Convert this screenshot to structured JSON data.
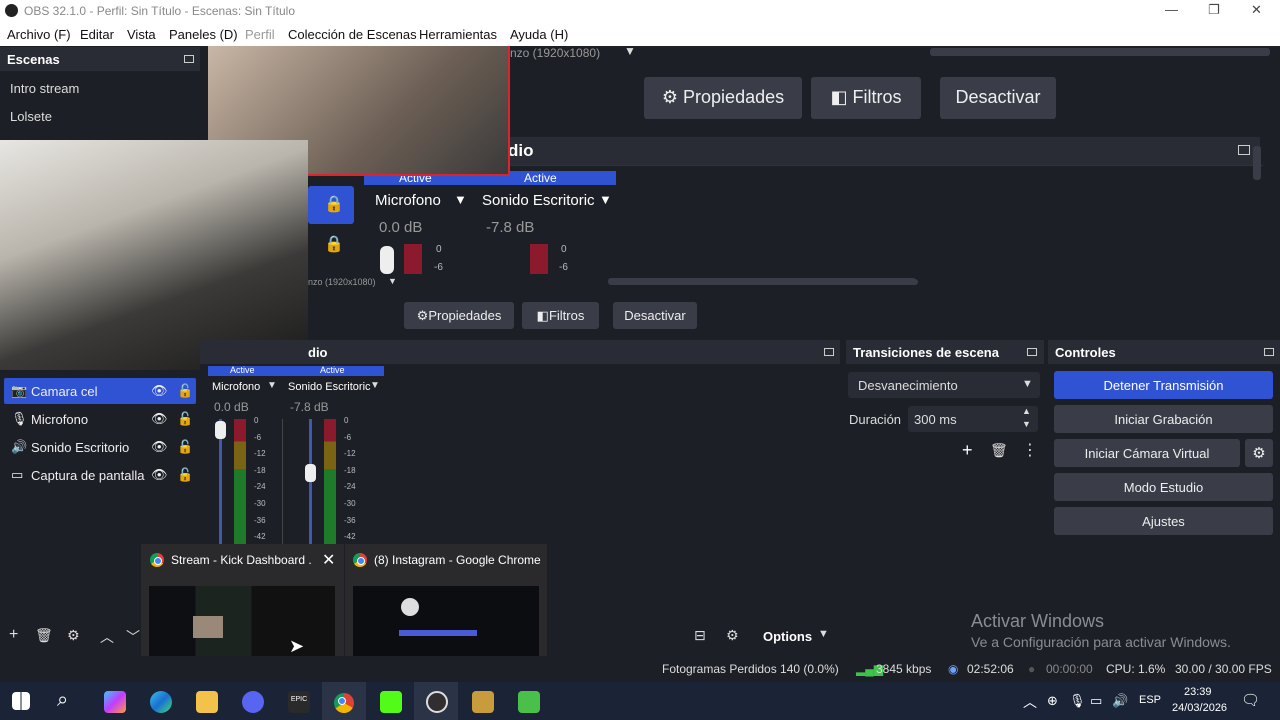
{
  "window": {
    "title": "OBS 32.1.0 - Perfil: Sin Título - Escenas: Sin Título",
    "minimize": "—",
    "maximize": "❐",
    "close": "✕"
  },
  "menu": [
    "Archivo (F)",
    "Editar",
    "Vista",
    "Paneles (D)",
    "Perfil",
    "Colección de Escenas",
    "Herramientas",
    "Ayuda (H)"
  ],
  "scenes": {
    "title": "Escenas",
    "items": [
      "Intro stream",
      "Lolsete"
    ]
  },
  "preview": {
    "canvas_label": "nzo (1920x1080)",
    "canvas_label_small": "nzo (1920x1080)"
  },
  "toolbar_large": {
    "properties": "Propiedades",
    "filters": "Filtros",
    "deactivate": "Desactivar"
  },
  "toolbar_small": {
    "properties": "Propiedades",
    "filters": "Filtros",
    "deactivate": "Desactivar"
  },
  "audio_mixer": {
    "title_partial": "dio",
    "title_partial_large": "dio",
    "active_label": "Active",
    "channels": [
      {
        "name": "Microfono",
        "db": "0.0 dB",
        "level": 0.0
      },
      {
        "name": "Sonido Escritoric",
        "db": "-7.8 dB",
        "level": 0.62
      }
    ],
    "scale": [
      "0",
      "-6",
      "-12",
      "-18",
      "-24",
      "-30",
      "-36",
      "-42"
    ],
    "scale_large": [
      "0",
      "-6"
    ]
  },
  "sources": {
    "items": [
      {
        "label": "Camara cel",
        "icon": "camera-icon",
        "selected": true
      },
      {
        "label": "Microfono",
        "icon": "mic-icon",
        "selected": false
      },
      {
        "label": "Sonido Escritorio",
        "icon": "speaker-icon",
        "selected": false
      },
      {
        "label": "Captura de pantalla",
        "icon": "monitor-icon",
        "selected": false
      }
    ]
  },
  "transitions": {
    "title": "Transiciones de escena",
    "selected": "Desvanecimiento",
    "duration_label": "Duración",
    "duration_value": "300 ms"
  },
  "controls": {
    "title": "Controles",
    "stop_stream": "Detener Transmisión",
    "start_record": "Iniciar Grabación",
    "start_vcam": "Iniciar Cámara Virtual",
    "studio_mode": "Modo Estudio",
    "settings": "Ajustes"
  },
  "mixer_footer": {
    "options": "Options"
  },
  "taskbar_previews": [
    {
      "title": "Stream - Kick Dashboard ..."
    },
    {
      "title": "(8) Instagram - Google Chrome"
    }
  ],
  "activate_windows": {
    "line1": "Activar Windows",
    "line2": "Ve a Configuración para activar Windows."
  },
  "status": {
    "dropped": "Fotogramas Perdidos 140 (0.0%)",
    "bitrate": "3845 kbps",
    "stream_time": "02:52:06",
    "record_time": "00:00:00",
    "cpu": "CPU: 1.6%",
    "fps": "30.00 / 30.00 FPS"
  },
  "tray": {
    "lang": "ESP",
    "time": "23:39",
    "date": "24/03/2026"
  },
  "colors": {
    "accent": "#2f53d3",
    "bg": "#1d1f26",
    "panel": "#2a2c35",
    "button": "#3a3d48"
  }
}
